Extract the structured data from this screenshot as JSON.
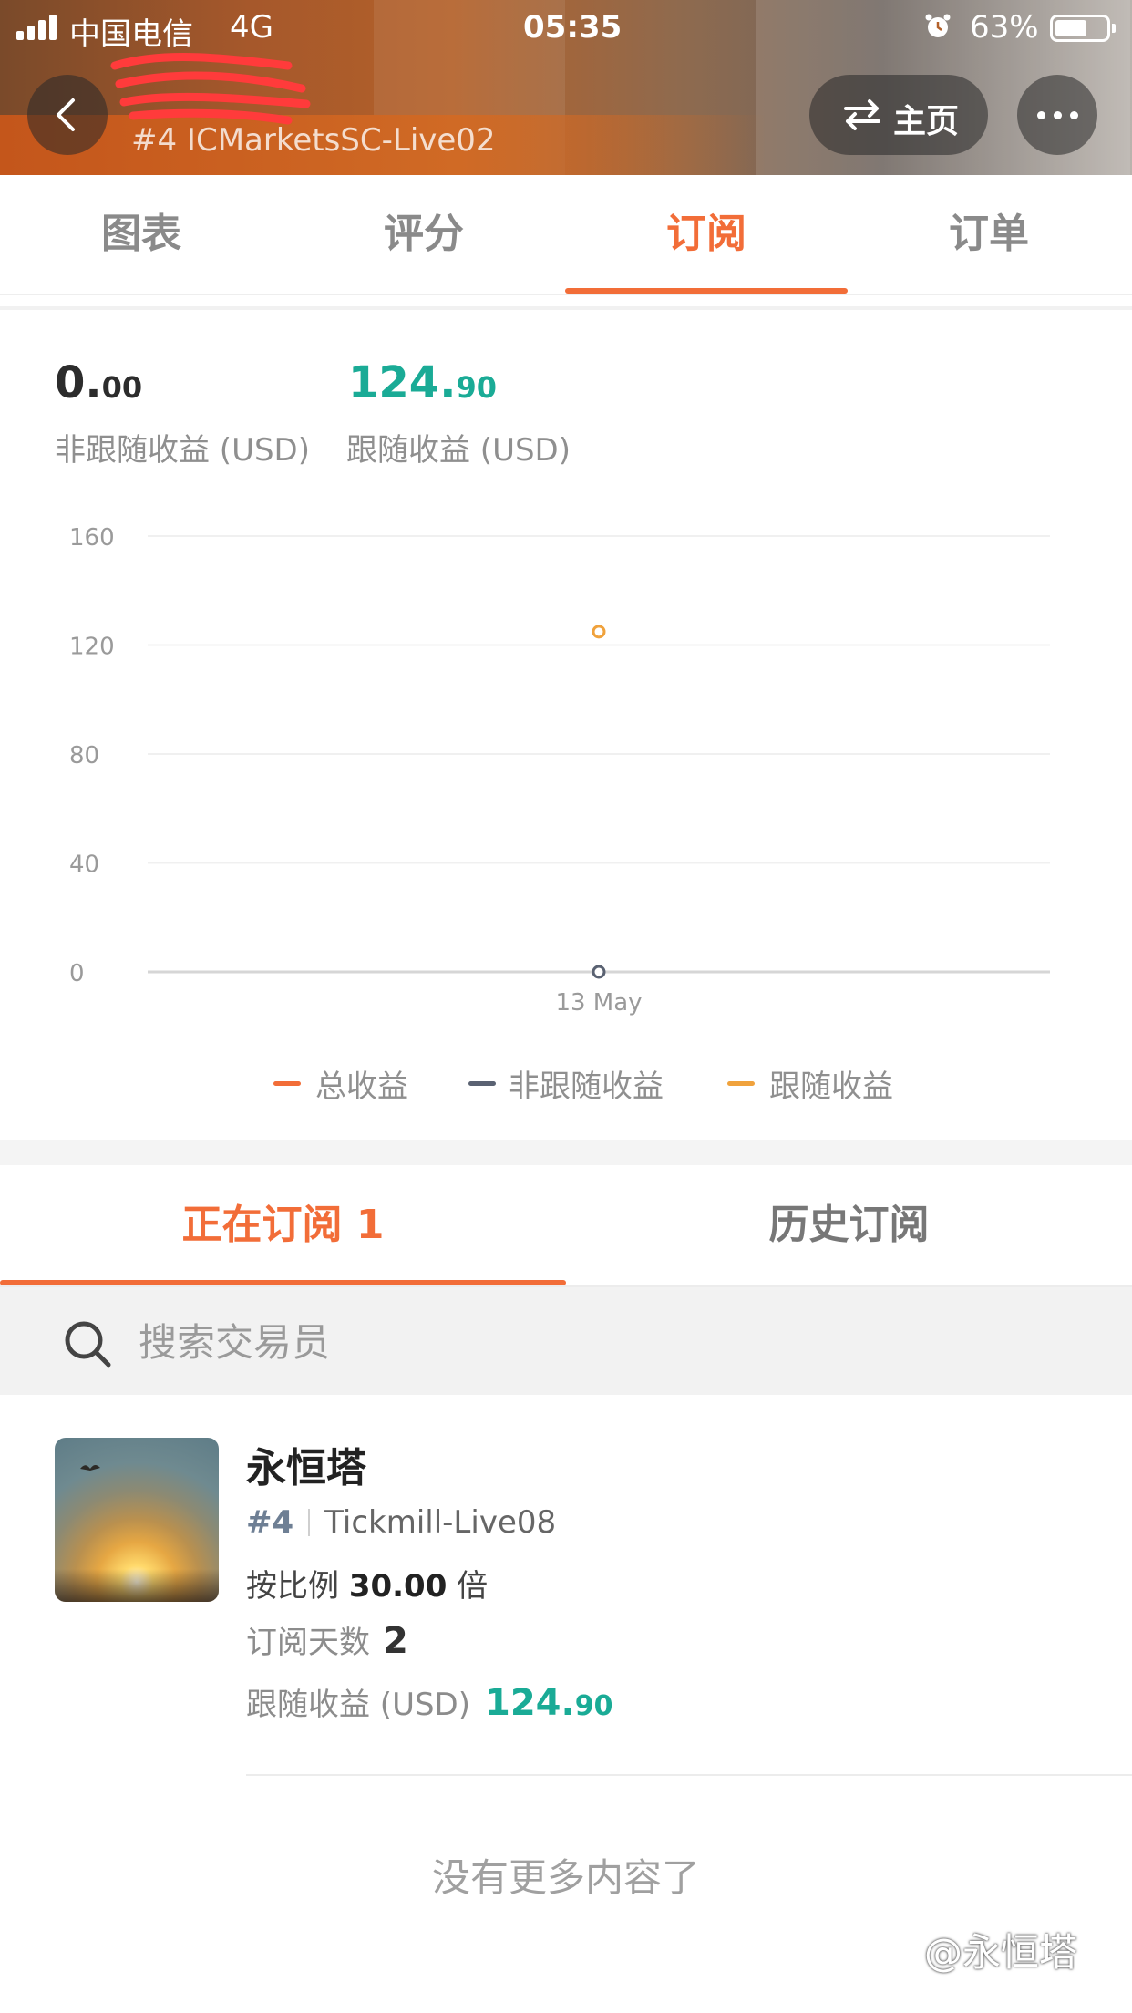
{
  "status_bar": {
    "carrier": "中国电信",
    "network": "4G",
    "time": "05:35",
    "battery": "63%",
    "battery_level": 0.63
  },
  "header": {
    "account_name": "[redacted]",
    "account_sub": "#4 ICMarketsSC-Live02",
    "home_label": "主页"
  },
  "tabs": [
    {
      "label": "图表",
      "active": false
    },
    {
      "label": "评分",
      "active": false
    },
    {
      "label": "订阅",
      "active": true
    },
    {
      "label": "订单",
      "active": false
    }
  ],
  "stats": {
    "non_follow": {
      "int": "0.",
      "dec": "00",
      "label": "非跟随收益 (USD)"
    },
    "follow": {
      "int": "124.",
      "dec": "90",
      "label": "跟随收益 (USD)"
    }
  },
  "chart_data": {
    "type": "scatter",
    "y_ticks": [
      "160",
      "120",
      "80",
      "40",
      "0"
    ],
    "ylim": [
      0,
      160
    ],
    "categories": [
      "13 May"
    ],
    "grid": true,
    "legend_position": "bottom",
    "series": [
      {
        "name": "总收益",
        "color": "#f26d38",
        "values": [
          null
        ]
      },
      {
        "name": "非跟随收益",
        "color": "#5a6272",
        "values": [
          0
        ]
      },
      {
        "name": "跟随收益",
        "color": "#f0a23c",
        "values": [
          124.9
        ]
      }
    ]
  },
  "sub_tabs": {
    "current": "正在订阅 1",
    "history": "历史订阅"
  },
  "search": {
    "placeholder": "搜索交易员"
  },
  "subscription": {
    "name": "永恒塔",
    "rank": "#4",
    "broker": "Tickmill-Live08",
    "ratio_prefix": "按比例",
    "ratio_value": "30.00",
    "ratio_suffix": "倍",
    "days_label": "订阅天数",
    "days_value": "2",
    "profit_label": "跟随收益 (USD)",
    "profit_int": "124.",
    "profit_dec": "90"
  },
  "footer": {
    "no_more": "没有更多内容了"
  },
  "watermark": "@永恒塔",
  "colors": {
    "accent": "#f26d38",
    "positive": "#1aab96"
  }
}
